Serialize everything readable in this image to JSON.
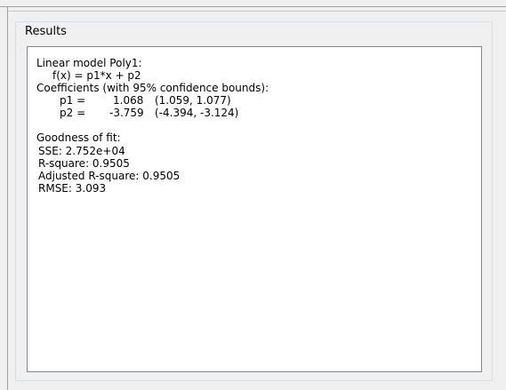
{
  "panel": {
    "title": "Results"
  },
  "results": {
    "model_header": "Linear model Poly1:",
    "model_formula": "f(x) = p1*x + p2",
    "coefficients_header": "Coefficients (with 95% confidence bounds):",
    "coefficients": [
      {
        "name": "p1 =",
        "value": "1.068",
        "bounds": "(1.059, 1.077)"
      },
      {
        "name": "p2 =",
        "value": "-3.759",
        "bounds": "(-4.394, -3.124)"
      }
    ],
    "gof_header": "Goodness of fit:",
    "gof": [
      "SSE: 2.752e+04",
      "R-square: 0.9505",
      "Adjusted R-square: 0.9505",
      "RMSE: 3.093"
    ]
  }
}
